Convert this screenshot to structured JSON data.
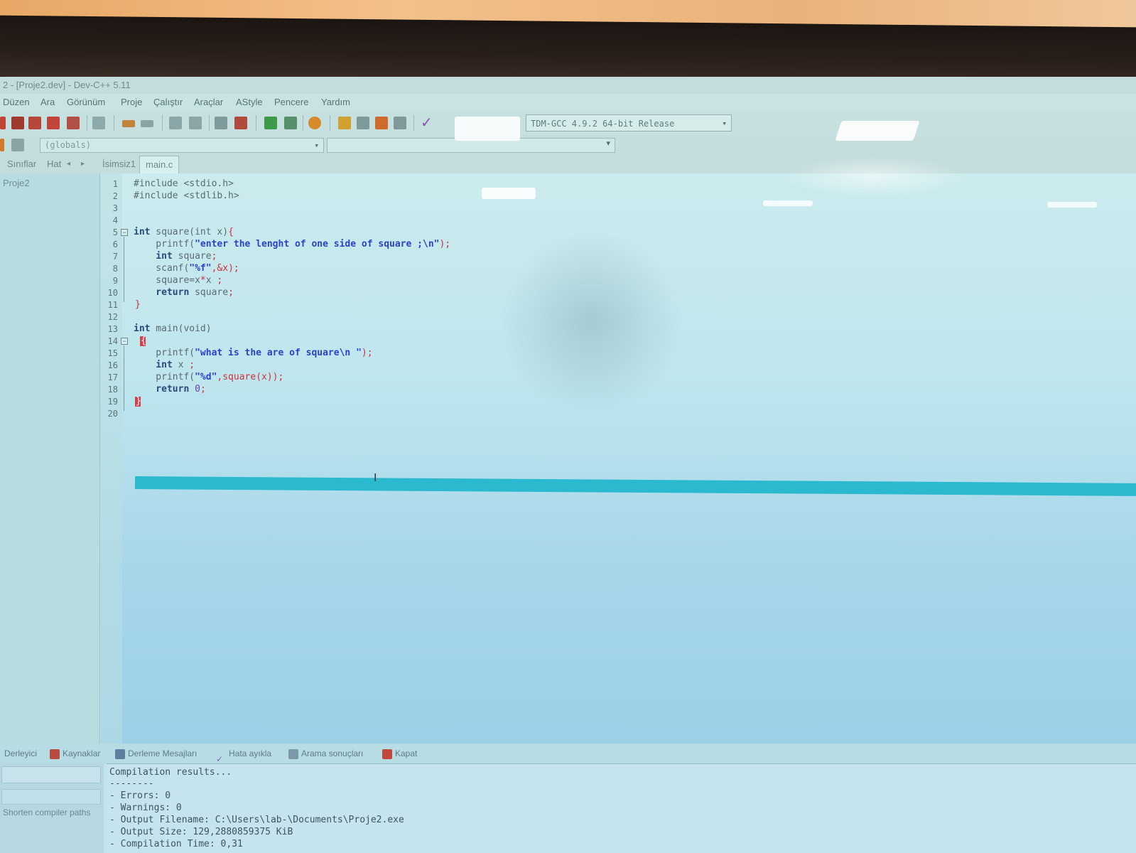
{
  "window": {
    "title": "2 - [Proje2.dev] - Dev-C++ 5.11"
  },
  "menu": [
    "Düzen",
    "Ara",
    "Görünüm",
    "Proje",
    "Çalıştır",
    "Araçlar",
    "AStyle",
    "Pencere",
    "Yardım"
  ],
  "toolbar": {
    "compiler": "TDM-GCC 4.9.2 64-bit Release",
    "scope": "(globals)"
  },
  "tabs": {
    "left": [
      "Sınıflar",
      "Hat"
    ],
    "files": [
      "İsimsiz1",
      "main.c"
    ]
  },
  "sidebar": {
    "project": "Proje2"
  },
  "editor": {
    "line_numbers": [
      "1",
      "2",
      "3",
      "4",
      "5",
      "6",
      "7",
      "8",
      "9",
      "10",
      "11",
      "12",
      "13",
      "14",
      "15",
      "16",
      "17",
      "18",
      "19",
      "20"
    ],
    "lines": {
      "l1": "#include <stdio.h>",
      "l2": "#include <stdlib.h>",
      "l5a": "int",
      "l5b": " square(int x)",
      "l5c": "{",
      "l6a": "    printf(",
      "l6b": "\"enter the lenght of one side of square ;\\n\"",
      "l6c": ");",
      "l7a": "    int",
      "l7b": " square",
      "l7c": ";",
      "l8a": "    scanf(",
      "l8b": "\"%f\"",
      "l8c": ",&x);",
      "l9a": "    square=x",
      "l9b": "*",
      "l9c": "x ",
      "l9d": ";",
      "l10a": "    return",
      "l10b": " square",
      "l10c": ";",
      "l11": "}",
      "l13a": "int",
      "l13b": " main(void)",
      "l14": "{",
      "l15a": "    printf(",
      "l15b": "\"what is the are of square\\n \"",
      "l15c": ");",
      "l16a": "    int",
      "l16b": " x ",
      "l16c": ";",
      "l17a": "    printf(",
      "l17b": "\"%d\"",
      "l17c": ",square(x));",
      "l18a": "    return",
      "l18b": " 0",
      "l18c": ";",
      "l19": "}"
    }
  },
  "bottom": {
    "tabs": [
      "Derleyici",
      "Kaynaklar",
      "Derleme Mesajları",
      "Hata ayıkla",
      "Arama sonuçları",
      "Kapat"
    ],
    "shorten_label": "Shorten compiler paths",
    "output": [
      "Compilation results...",
      "--------",
      "- Errors: 0",
      "- Warnings: 0",
      "- Output Filename: C:\\Users\\lab-\\Documents\\Proje2.exe",
      "- Output Size: 129,2880859375 KiB",
      "- Compilation Time: 0,31"
    ]
  },
  "colors": {
    "current_line": "#2ab9cf",
    "string": "#2a43c8",
    "symbol": "#d0303a",
    "bracket_highlight": "#d2414c"
  }
}
